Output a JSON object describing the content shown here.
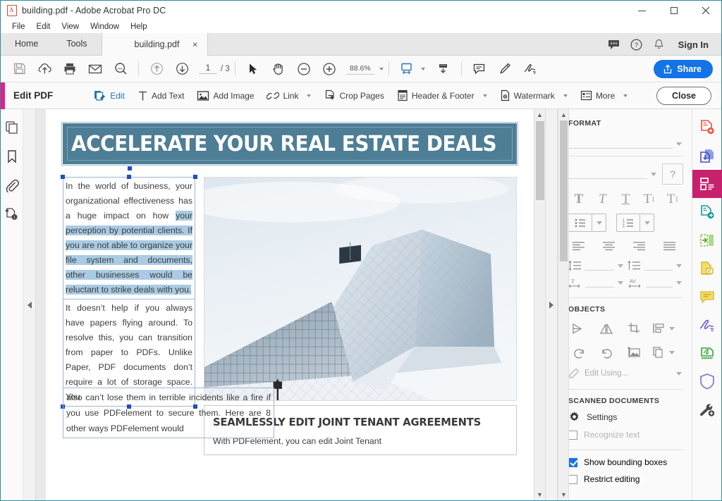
{
  "window": {
    "title": "building.pdf - Adobe Acrobat Pro DC",
    "app_icon": "pdf-file-icon",
    "minimize": "minimize-icon",
    "maximize": "maximize-icon",
    "close": "close-icon"
  },
  "menubar": {
    "items": [
      "File",
      "Edit",
      "View",
      "Window",
      "Help"
    ]
  },
  "tabs": {
    "home": "Home",
    "tools": "Tools",
    "document": "building.pdf",
    "close_glyph": "×"
  },
  "topright": {
    "comment_icon": "chat-bubble-icon",
    "help_icon": "help-circle-icon",
    "bell_icon": "notification-bell-icon",
    "sign_in": "Sign In"
  },
  "toolbar": {
    "save": "save-icon",
    "upload": "upload-cloud-icon",
    "print": "print-icon",
    "email": "email-icon",
    "search": "search-icon",
    "prev_page": "arrow-up-circle-icon",
    "next_page": "arrow-down-circle-icon",
    "page_current": "1",
    "page_total": "/ 3",
    "select_tool": "cursor-arrow-icon",
    "hand_tool": "hand-icon",
    "zoom_out": "zoom-out-icon",
    "zoom_in": "zoom-in-icon",
    "zoom_value": "88.6%",
    "fit_width": "fit-width-icon",
    "scroll_mode": "page-scroll-icon",
    "comment": "comment-icon",
    "highlight": "highlighter-icon",
    "sign": "sign-icon",
    "share_label": "Share",
    "share_color": "#1473e6"
  },
  "editbar": {
    "accent_color": "#e0218a",
    "title": "Edit PDF",
    "buttons": [
      {
        "label": "Edit",
        "icon": "edit-pdf-icon",
        "caret": false,
        "active": true
      },
      {
        "label": "Add Text",
        "icon": "add-text-icon",
        "caret": false,
        "active": false
      },
      {
        "label": "Add Image",
        "icon": "add-image-icon",
        "caret": false,
        "active": false
      },
      {
        "label": "Link",
        "icon": "link-icon",
        "caret": true,
        "active": false
      },
      {
        "label": "Crop Pages",
        "icon": "crop-pages-icon",
        "caret": false,
        "active": false
      },
      {
        "label": "Header & Footer",
        "icon": "header-footer-icon",
        "caret": true,
        "active": false
      },
      {
        "label": "Watermark",
        "icon": "watermark-icon",
        "caret": true,
        "active": false
      },
      {
        "label": "More",
        "icon": "more-list-icon",
        "caret": true,
        "active": false
      }
    ],
    "close_label": "Close"
  },
  "leftrail": {
    "items": [
      {
        "name": "page-thumbnails-icon"
      },
      {
        "name": "bookmarks-icon"
      },
      {
        "name": "attachments-icon"
      },
      {
        "name": "document-info-icon"
      }
    ]
  },
  "document": {
    "banner_title": "ACCELERATE YOUR REAL ESTATE DEALS",
    "banner_color": "#4e7e95",
    "paragraph_1_pre": "In the world of business, your organizational effectiveness has a huge impact on how ",
    "paragraph_1_hl": "your perception by potential clients. If you are not able to organize your file system and documents, other businesses would be reluctant to strike deals with you.",
    "paragraph_2": "It doesn’t help if you always have papers flying around. To resolve this, you can transition from paper to PDFs. Unlike Paper, PDF documents don’t require a lot of storage space. You",
    "paragraph_3": "also can’t lose them in terrible incidents like a fire if you use PDFelement to secure them. Here are 8 other ways PDFelement would",
    "card_heading": "SEAMLESSLY EDIT JOINT TENANT AGREEMENTS",
    "card_body": "With PDFelement, you can edit Joint Tenant",
    "image_alt": "modern-angular-glass-building-photo",
    "selection_color": "#a9cbe3",
    "handle_color": "#1f4fbf"
  },
  "rightpanel": {
    "format_heading": "FORMAT",
    "help_icon": "help-circle-icon",
    "text_style_buttons": [
      "bold-T-icon",
      "italic-T-icon",
      "underline-T-icon",
      "superscript-T-icon",
      "subscript-T-icon"
    ],
    "list_buttons": [
      "bulleted-list-icon",
      "numbered-list-icon"
    ],
    "align_buttons": [
      "align-left-icon",
      "align-center-icon",
      "align-right-icon",
      "align-justify-icon"
    ],
    "spacing_buttons": [
      "line-spacing-icon",
      "paragraph-spacing-icon"
    ],
    "char_buttons": [
      "horizontal-scale-icon",
      "character-spacing-icon"
    ],
    "objects_heading": "OBJECTS",
    "object_buttons_row1": [
      "flip-horizontal-icon",
      "flip-vertical-icon",
      "crop-icon",
      "align-objects-icon"
    ],
    "object_buttons_row2": [
      "rotate-ccw-icon",
      "rotate-cw-icon",
      "replace-image-icon",
      "arrange-icon"
    ],
    "edit_using": "Edit Using...",
    "edit_using_icon": "pencil-icon",
    "scanned_heading": "SCANNED DOCUMENTS",
    "settings_label": "Settings",
    "settings_icon": "gear-icon",
    "recognize_text_label": "Recognize text",
    "recognize_text_checked": false,
    "show_bounding_boxes_label": "Show bounding boxes",
    "show_bounding_boxes_checked": true,
    "restrict_editing_label": "Restrict editing",
    "restrict_editing_checked": false,
    "checkbox_accent": "#1473e6"
  },
  "iconrail": {
    "items": [
      {
        "name": "create-pdf-icon",
        "color": "#e8533f",
        "selected": false
      },
      {
        "name": "combine-files-icon",
        "color": "#5a5ad6",
        "selected": false
      },
      {
        "name": "edit-pdf-icon",
        "color": "#ffffff",
        "selected": true
      },
      {
        "name": "export-pdf-icon",
        "color": "#1a9a9a",
        "selected": false
      },
      {
        "name": "organize-pages-icon",
        "color": "#76c043",
        "selected": false
      },
      {
        "name": "comment-pages-icon",
        "color": "#e0c020",
        "selected": false
      },
      {
        "name": "comment-bubble-icon",
        "color": "#e0c020",
        "selected": false
      },
      {
        "name": "fill-and-sign-icon",
        "color": "#7a5ad6",
        "selected": false
      },
      {
        "name": "send-for-signature-icon",
        "color": "#37a63a",
        "selected": false
      },
      {
        "name": "protect-icon",
        "color": "#7a7ad0",
        "selected": false
      },
      {
        "name": "more-tools-icon",
        "color": "#4a4a4a",
        "selected": false
      }
    ]
  },
  "scrollbars": {
    "doc_up": "▲",
    "doc_down": "▼",
    "panel_up": "▲",
    "panel_down": "▼",
    "collapse_left": "collapse-left-arrow-icon",
    "collapse_right": "collapse-right-arrow-icon"
  }
}
